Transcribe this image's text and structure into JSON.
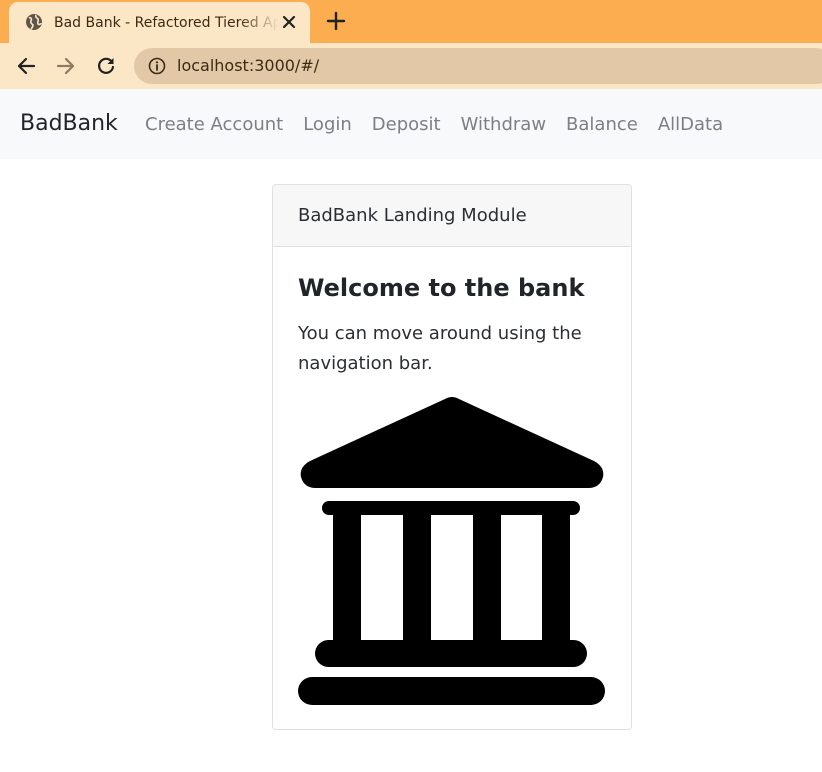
{
  "browser": {
    "tab_title": "Bad Bank - Refactored Tiered App",
    "url": "localhost:3000/#/",
    "icons": {
      "tab": "globe-icon",
      "close": "close-icon",
      "new_tab": "plus-icon",
      "back": "arrow-left-icon",
      "forward": "arrow-right-icon",
      "reload": "reload-icon",
      "site_info": "info-icon"
    },
    "colors": {
      "tab_strip": "#fbad50",
      "toolbar": "#fbe7c6",
      "omnibox": "#e2c8a6"
    }
  },
  "navbar": {
    "brand": "BadBank",
    "links": [
      "Create Account",
      "Login",
      "Deposit",
      "Withdraw",
      "Balance",
      "AllData"
    ]
  },
  "card": {
    "header": "BadBank Landing Module",
    "title": "Welcome to the bank",
    "text": "You can move around using the navigation bar.",
    "image_icon": "bank-icon"
  }
}
